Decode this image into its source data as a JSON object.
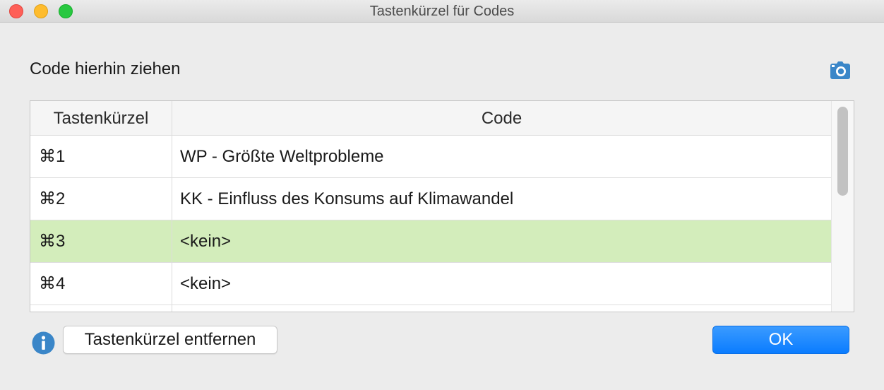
{
  "window": {
    "title": "Tastenkürzel für Codes"
  },
  "drop_hint": "Code hierhin ziehen",
  "table": {
    "headers": {
      "shortcut": "Tastenkürzel",
      "code": "Code"
    },
    "rows": [
      {
        "shortcut": "⌘1",
        "code": "WP - Größte Weltprobleme",
        "selected": false
      },
      {
        "shortcut": "⌘2",
        "code": "KK - Einfluss des Konsums auf Klimawandel",
        "selected": false
      },
      {
        "shortcut": "⌘3",
        "code": "<kein>",
        "selected": true
      },
      {
        "shortcut": "⌘4",
        "code": "<kein>",
        "selected": false
      }
    ]
  },
  "buttons": {
    "remove_shortcut": "Tastenkürzel entfernen",
    "ok": "OK"
  },
  "icons": {
    "camera": "camera-icon",
    "info": "info-icon"
  },
  "colors": {
    "selected_row": "#d3edbb",
    "accent": "#0a7cff",
    "icon_blue": "#3a86c8"
  }
}
